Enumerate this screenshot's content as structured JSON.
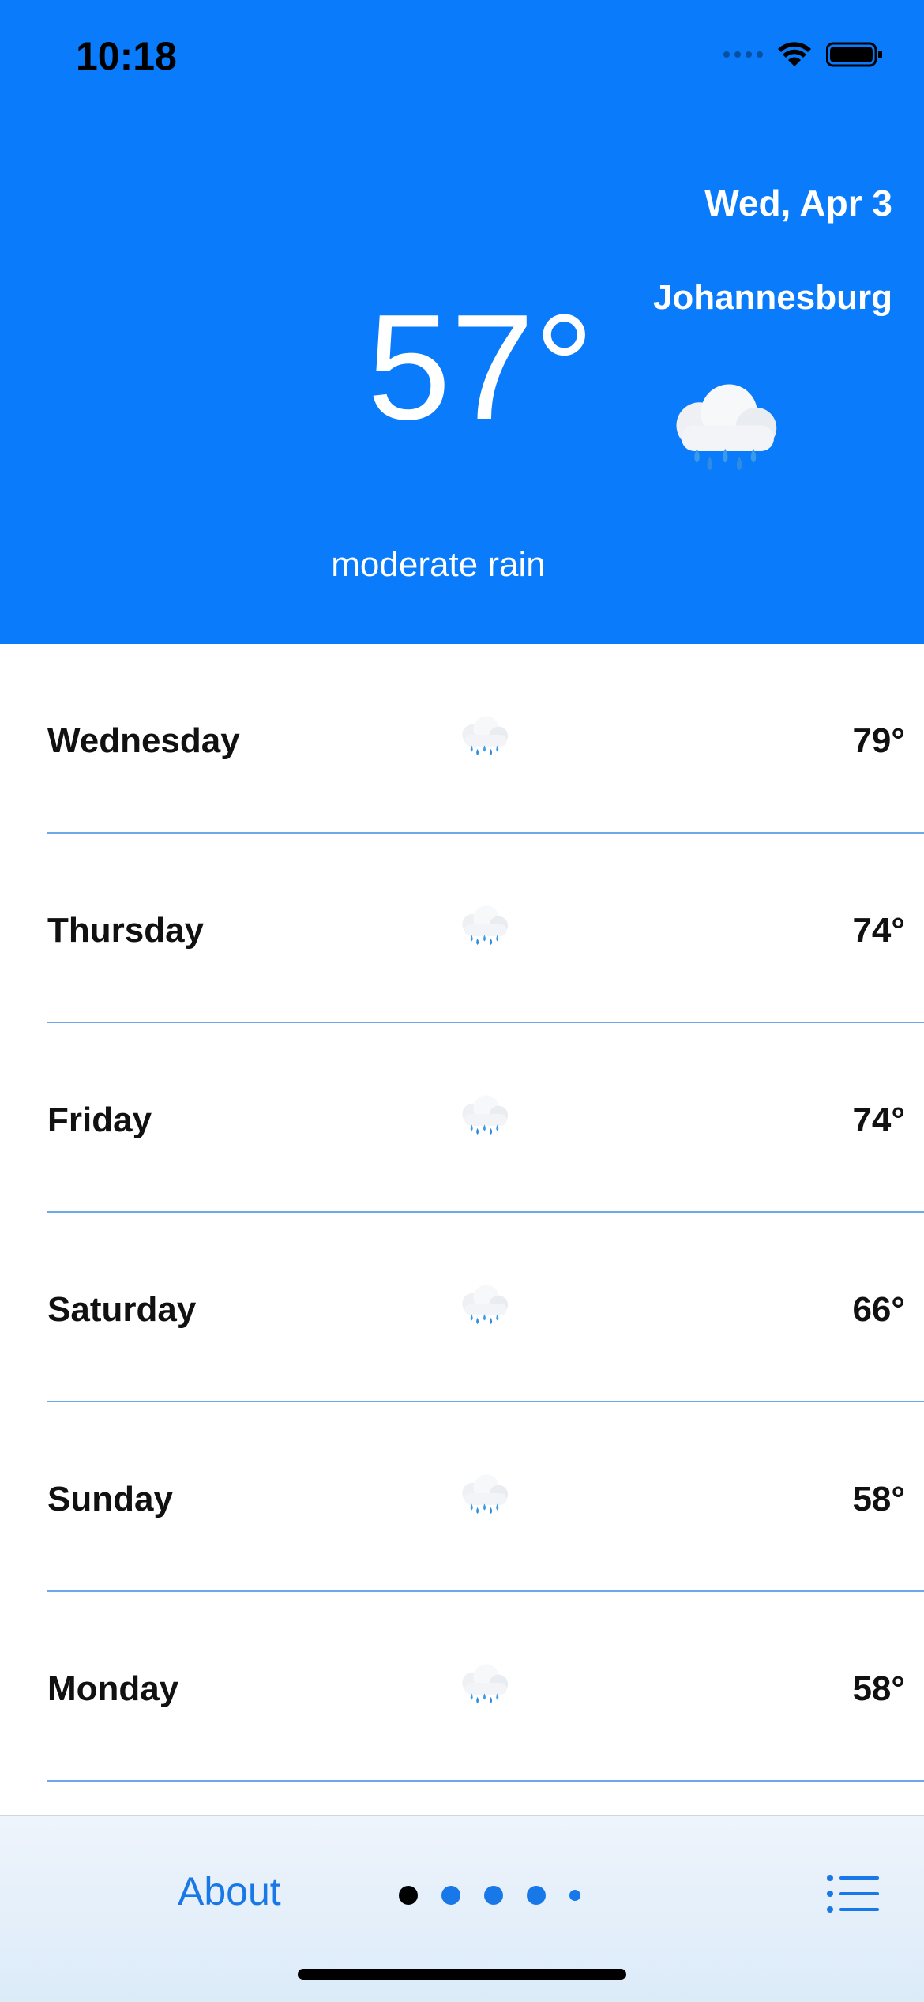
{
  "status_bar": {
    "time": "10:18"
  },
  "current": {
    "date": "Wed, Apr 3",
    "city": "Johannesburg",
    "temperature": "57°",
    "description": "moderate rain",
    "icon": "cloud-rain-icon"
  },
  "forecast": [
    {
      "day": "Wednesday",
      "temp": "79°",
      "icon": "cloud-rain-icon"
    },
    {
      "day": "Thursday",
      "temp": "74°",
      "icon": "cloud-rain-icon"
    },
    {
      "day": "Friday",
      "temp": "74°",
      "icon": "cloud-rain-icon"
    },
    {
      "day": "Saturday",
      "temp": "66°",
      "icon": "cloud-rain-icon"
    },
    {
      "day": "Sunday",
      "temp": "58°",
      "icon": "cloud-rain-icon"
    },
    {
      "day": "Monday",
      "temp": "58°",
      "icon": "cloud-rain-icon"
    }
  ],
  "toolbar": {
    "about_label": "About",
    "page_count": 5,
    "current_page": 1,
    "list_icon": "list-icon"
  },
  "colors": {
    "header_bg": "#0a7bfb",
    "accent": "#1978e8",
    "divider": "#6ea8ea"
  }
}
